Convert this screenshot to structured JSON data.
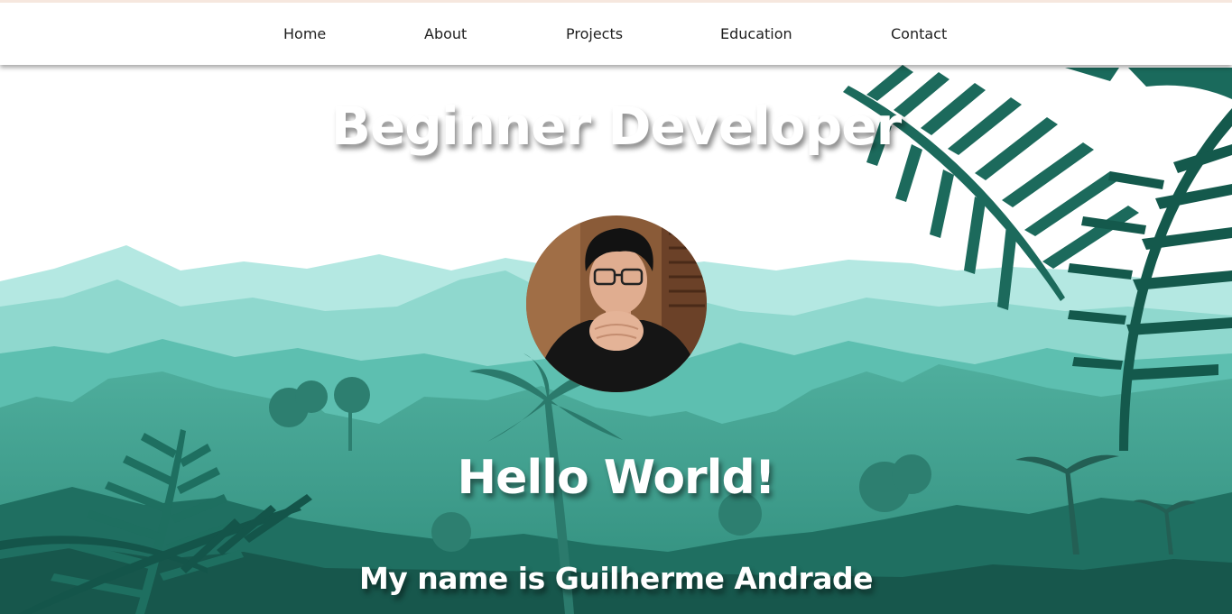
{
  "nav": {
    "items": [
      {
        "label": "Home"
      },
      {
        "label": "About"
      },
      {
        "label": "Projects"
      },
      {
        "label": "Education"
      },
      {
        "label": "Contact"
      }
    ]
  },
  "hero": {
    "title": "Beginner Developer",
    "greeting": "Hello World!",
    "intro": "My name is Guilherme Andrade"
  },
  "colors": {
    "sky": "#ffffff",
    "mountain_far": "#b4e8e2",
    "mountain_mid": "#8fd8ce",
    "hills": "#5dbfb0",
    "forest": "#2f8c7b",
    "foliage_dark": "#15594c",
    "heading_text": "#ffffff",
    "nav_text": "#1e1e1e"
  },
  "icons": {
    "avatar": "profile-photo"
  }
}
